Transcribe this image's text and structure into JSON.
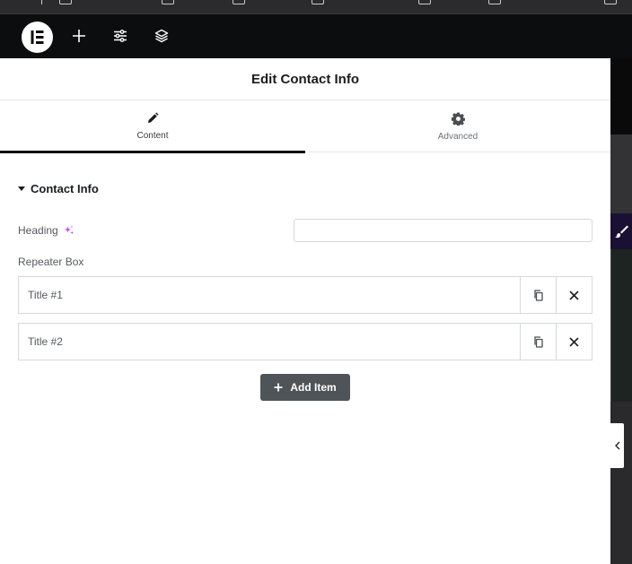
{
  "topbar": {
    "logo_icon": "elementor-logo-icon",
    "add_icon": "plus-icon",
    "settings_icon": "sliders-icon",
    "structure_icon": "layers-icon"
  },
  "panel": {
    "title": "Edit Contact Info",
    "tabs": [
      {
        "label": "Content",
        "icon": "pencil-icon",
        "active": true
      },
      {
        "label": "Advanced",
        "icon": "gear-icon",
        "active": false
      }
    ],
    "section": {
      "title": "Contact Info"
    },
    "heading": {
      "label": "Heading",
      "value": "",
      "ai_icon": "sparkle-icon"
    },
    "repeater": {
      "label": "Repeater Box",
      "items": [
        {
          "title": "Title #1"
        },
        {
          "title": "Title #2"
        }
      ],
      "add_label": "Add Item"
    }
  },
  "colors": {
    "topbar": "#0c0d0e",
    "add_button": "#4f5458",
    "ai_accent": "#c248e8"
  }
}
